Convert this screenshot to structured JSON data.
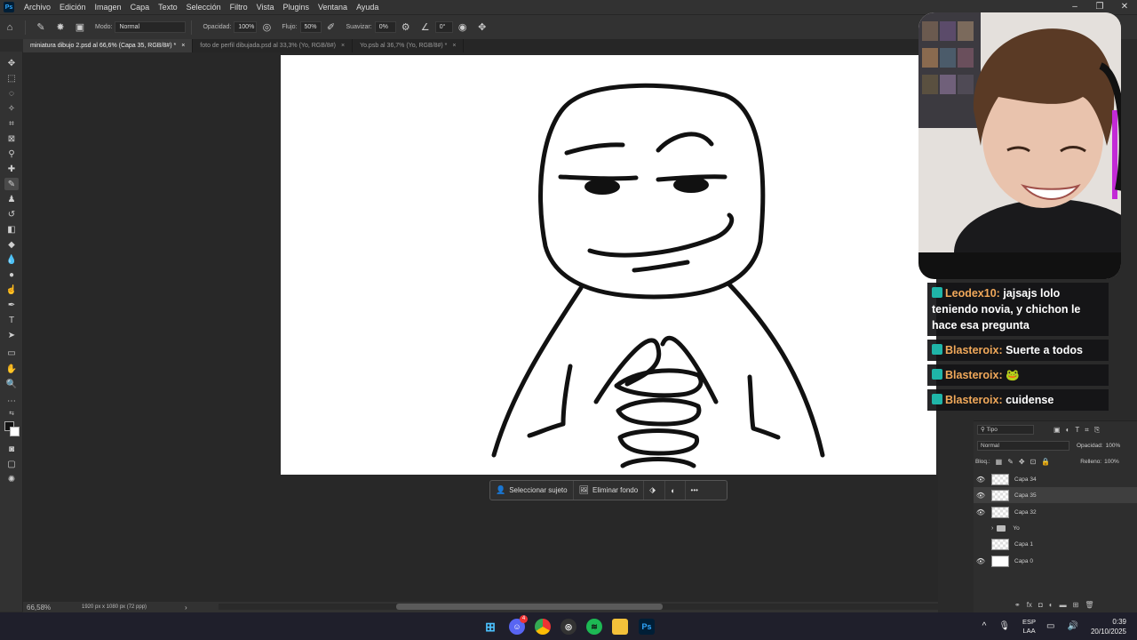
{
  "menubar": {
    "app_icon": "Ps",
    "items": [
      "Archivo",
      "Edición",
      "Imagen",
      "Capa",
      "Texto",
      "Selección",
      "Filtro",
      "Vista",
      "Plugins",
      "Ventana",
      "Ayuda"
    ]
  },
  "options": {
    "mode_label": "Modo:",
    "mode_value": "Normal",
    "opacity_label": "Opacidad:",
    "opacity_value": "100%",
    "flow_label": "Flujo:",
    "flow_value": "50%",
    "smooth_label": "Suavizar:",
    "smooth_value": "0%",
    "angle_value": "0°"
  },
  "tabs": [
    {
      "label": "miniatura dibujo 2.psd al 66,6% (Capa 35, RGB/8#) *",
      "close": "×"
    },
    {
      "label": "foto de perfil dibujada.psd al 33,3% (Yo, RGB/8#)",
      "close": "×"
    },
    {
      "label": "Yo.psb al 36,7% (Yo, RGB/8#) *",
      "close": "×"
    }
  ],
  "context_bar": {
    "select_subject": "Seleccionar sujeto",
    "remove_bg": "Eliminar fondo",
    "more": "•••"
  },
  "status": {
    "zoom": "66,58%",
    "dims": "1920 px x 1080 px (72 ppp)",
    "arrow": "›"
  },
  "chat": [
    {
      "user": "Leodex10:",
      "text": "jajsajs lolo teniendo novia, y chichon le hace esa pregunta"
    },
    {
      "user": "Blasteroix:",
      "text": "Suerte a todos"
    },
    {
      "user": "Blasteroix:",
      "text": "🐸"
    },
    {
      "user": "Blasteroix:",
      "text": "cuidense"
    }
  ],
  "layers": {
    "filter_label": "Tipo",
    "blend": "Normal",
    "opacity_label": "Opacidad:",
    "opacity_value": "100%",
    "lock_label": "Bloq.:",
    "fill_label": "Relleno:",
    "fill_value": "100%",
    "items": [
      {
        "name": "Capa 34",
        "visible": true,
        "kind": "checker"
      },
      {
        "name": "Capa 35",
        "visible": true,
        "kind": "checker"
      },
      {
        "name": "Capa 32",
        "visible": true,
        "kind": "checker"
      },
      {
        "name": "Yo",
        "visible": false,
        "kind": "folder"
      },
      {
        "name": "Capa 1",
        "visible": false,
        "kind": "checker"
      },
      {
        "name": "Capa 0",
        "visible": true,
        "kind": "white"
      }
    ],
    "active": "Capa 35"
  },
  "taskbar": {
    "lang_top": "ESP",
    "lang_bottom": "LAA",
    "time": "0:39",
    "date": "20/10/2025",
    "discord_badge": "4"
  },
  "colors": {
    "accent": "#31a8ff",
    "chat_user": "#f0a85a",
    "chat_badge": "#1fb5a8"
  }
}
